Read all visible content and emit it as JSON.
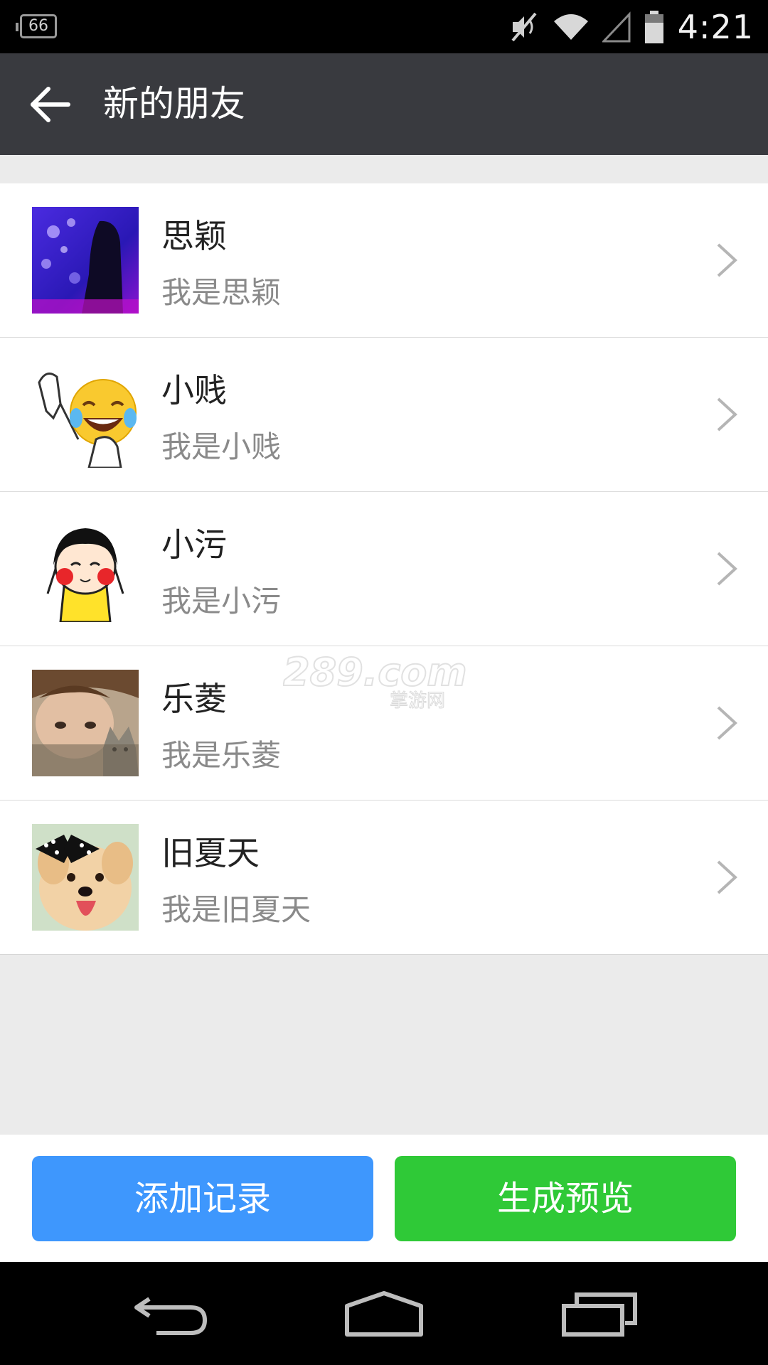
{
  "status_bar": {
    "notification_count": "66",
    "time": "4:21",
    "icons": [
      "mute-icon",
      "wifi-icon",
      "signal-icon",
      "battery-icon"
    ]
  },
  "app_bar": {
    "title": "新的朋友",
    "back_icon": "arrow-left-icon"
  },
  "friends": [
    {
      "name": "思颖",
      "message": "我是思颖",
      "avatar": "photo-girl-jellyfish"
    },
    {
      "name": "小贱",
      "message": "我是小贱",
      "avatar": "emoji-laughing-tears"
    },
    {
      "name": "小污",
      "message": "我是小污",
      "avatar": "cartoon-girl"
    },
    {
      "name": "乐菱",
      "message": "我是乐菱",
      "avatar": "photo-girl-cat"
    },
    {
      "name": "旧夏天",
      "message": "我是旧夏天",
      "avatar": "photo-dog-bow"
    }
  ],
  "actions": {
    "add_record": "添加记录",
    "generate_preview": "生成预览"
  },
  "colors": {
    "app_bar": "#393a3f",
    "blue_button": "#3e97fd",
    "green_button": "#2fc937"
  },
  "watermark": {
    "main": "289.com",
    "sub": "掌游网"
  }
}
